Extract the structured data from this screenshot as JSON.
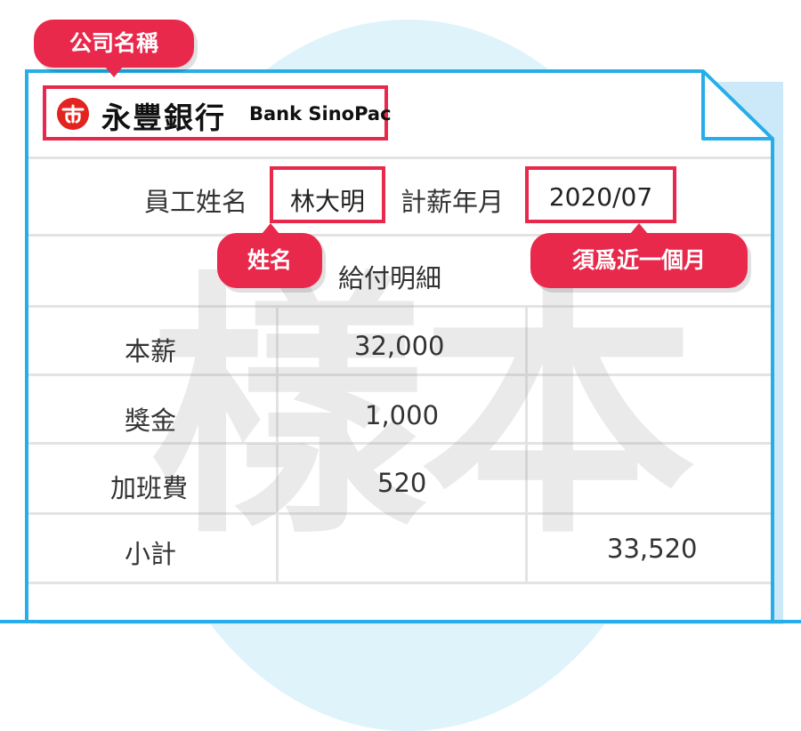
{
  "callouts": {
    "company": "公司名稱",
    "name": "姓名",
    "month": "須爲近一個月"
  },
  "logo": {
    "chinese": "永豐銀行",
    "english": "Bank SinoPac"
  },
  "header": {
    "name_label": "員工姓名",
    "name_value": "林大明",
    "month_label": "計薪年月",
    "month_value": "2020/07"
  },
  "section_title": "給付明細",
  "rows": [
    {
      "label": "本薪",
      "value": "32,000"
    },
    {
      "label": "獎金",
      "value": "1,000"
    },
    {
      "label": "加班費",
      "value": "520"
    },
    {
      "label": "小計",
      "total": "33,520"
    }
  ],
  "watermark": "樣本",
  "colors": {
    "accent_red": "#e8294c",
    "border_blue": "#27aee8",
    "circle_bg": "#dff3fb"
  }
}
